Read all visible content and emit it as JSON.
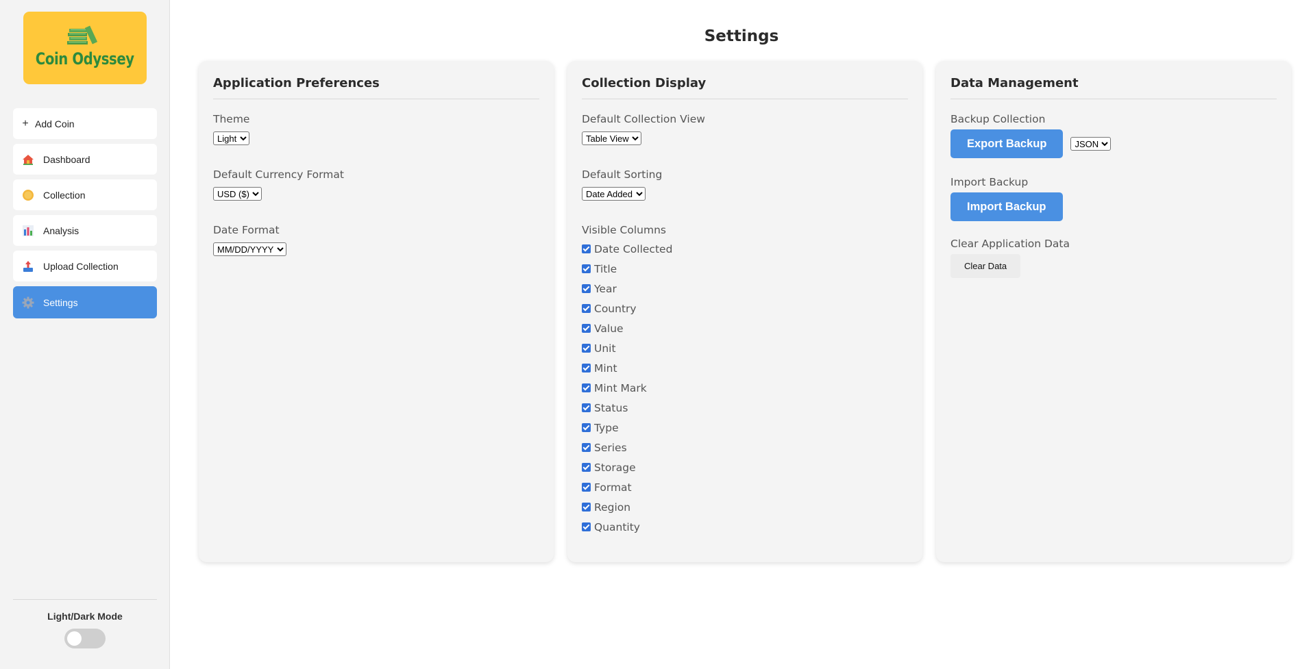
{
  "app": {
    "logo_text": "Coin Odyssey"
  },
  "sidebar": {
    "items": [
      {
        "label": "Add Coin",
        "icon": "plus-icon"
      },
      {
        "label": "Dashboard",
        "icon": "house-icon"
      },
      {
        "label": "Collection",
        "icon": "coin-icon"
      },
      {
        "label": "Analysis",
        "icon": "bar-chart-icon"
      },
      {
        "label": "Upload Collection",
        "icon": "upload-icon"
      },
      {
        "label": "Settings",
        "icon": "gear-icon",
        "active": true
      }
    ],
    "mode_label": "Light/Dark Mode",
    "dark_mode": false
  },
  "page": {
    "title": "Settings"
  },
  "app_prefs": {
    "title": "Application Preferences",
    "theme_label": "Theme",
    "theme_value": "Light",
    "currency_label": "Default Currency Format",
    "currency_value": "USD ($)",
    "date_label": "Date Format",
    "date_value": "MM/DD/YYYY"
  },
  "collection_display": {
    "title": "Collection Display",
    "view_label": "Default Collection View",
    "view_value": "Table View",
    "sorting_label": "Default Sorting",
    "sorting_value": "Date Added",
    "columns_label": "Visible Columns",
    "columns": [
      {
        "label": "Date Collected",
        "checked": true
      },
      {
        "label": "Title",
        "checked": true
      },
      {
        "label": "Year",
        "checked": true
      },
      {
        "label": "Country",
        "checked": true
      },
      {
        "label": "Value",
        "checked": true
      },
      {
        "label": "Unit",
        "checked": true
      },
      {
        "label": "Mint",
        "checked": true
      },
      {
        "label": "Mint Mark",
        "checked": true
      },
      {
        "label": "Status",
        "checked": true
      },
      {
        "label": "Type",
        "checked": true
      },
      {
        "label": "Series",
        "checked": true
      },
      {
        "label": "Storage",
        "checked": true
      },
      {
        "label": "Format",
        "checked": true
      },
      {
        "label": "Region",
        "checked": true
      },
      {
        "label": "Quantity",
        "checked": true
      }
    ]
  },
  "data_mgmt": {
    "title": "Data Management",
    "backup_label": "Backup Collection",
    "export_button": "Export Backup",
    "format_value": "JSON",
    "import_label": "Import Backup",
    "import_button": "Import Backup",
    "clear_label": "Clear Application Data",
    "clear_button": "Clear Data"
  },
  "colors": {
    "accent": "#4a90e2",
    "logo_bg": "#ffc83a",
    "logo_text": "#2d8a3e"
  }
}
